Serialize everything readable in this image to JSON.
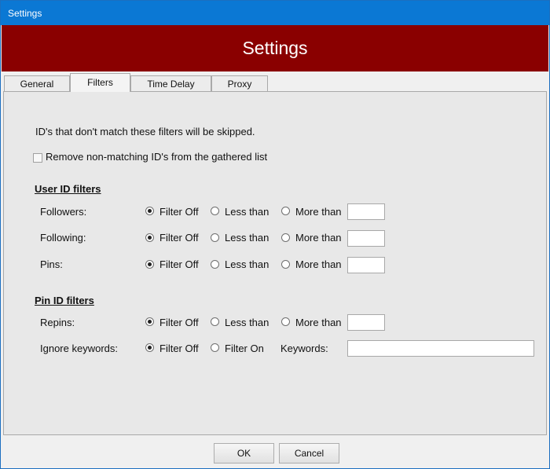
{
  "window": {
    "title": "Settings"
  },
  "header": {
    "title": "Settings"
  },
  "tabs": [
    {
      "label": "General"
    },
    {
      "label": "Filters"
    },
    {
      "label": "Time Delay"
    },
    {
      "label": "Proxy"
    }
  ],
  "filters": {
    "intro": "ID's that don't match these filters will be skipped.",
    "remove_checkbox_label": "Remove non-matching ID's from the gathered list",
    "remove_checked": false,
    "user_heading": "User ID filters",
    "pin_heading": "Pin ID filters",
    "rows": [
      {
        "label": "Followers:",
        "opt1": "Filter Off",
        "opt2": "Less than",
        "opt3": "More than",
        "value": "",
        "selected": "Filter Off"
      },
      {
        "label": "Following:",
        "opt1": "Filter Off",
        "opt2": "Less than",
        "opt3": "More than",
        "value": "",
        "selected": "Filter Off"
      },
      {
        "label": "Pins:",
        "opt1": "Filter Off",
        "opt2": "Less than",
        "opt3": "More than",
        "value": "",
        "selected": "Filter Off"
      },
      {
        "label": "Repins:",
        "opt1": "Filter Off",
        "opt2": "Less than",
        "opt3": "More than",
        "value": "",
        "selected": "Filter Off"
      }
    ],
    "keywords": {
      "label": "Ignore keywords:",
      "opt1": "Filter Off",
      "opt2": "Filter On",
      "keywords_label": "Keywords:",
      "value": "",
      "selected": "Filter Off"
    }
  },
  "buttons": {
    "ok": "OK",
    "cancel": "Cancel"
  }
}
